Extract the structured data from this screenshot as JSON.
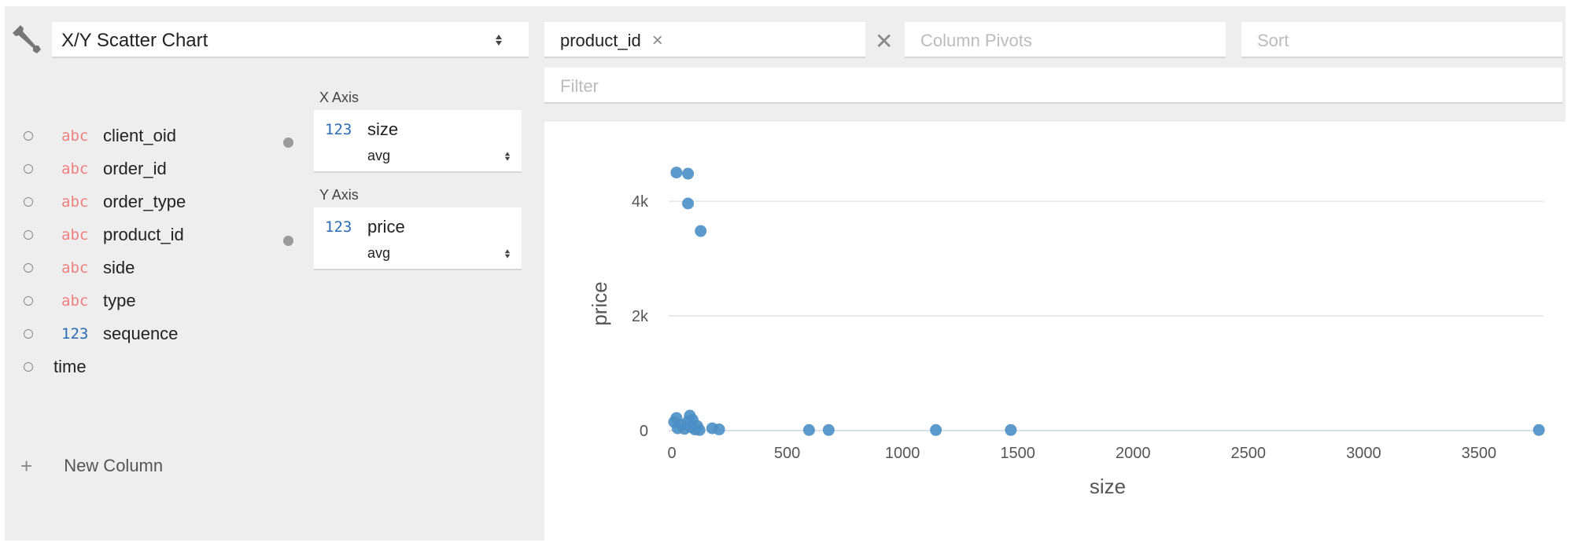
{
  "toolbar": {
    "chart_type": "X/Y Scatter Chart",
    "wrench_icon": "wrench-icon"
  },
  "columns": [
    {
      "type": "abc",
      "name": "client_oid"
    },
    {
      "type": "abc",
      "name": "order_id"
    },
    {
      "type": "abc",
      "name": "order_type"
    },
    {
      "type": "abc",
      "name": "product_id"
    },
    {
      "type": "abc",
      "name": "side"
    },
    {
      "type": "abc",
      "name": "type"
    },
    {
      "type": "123",
      "name": "sequence"
    },
    {
      "type": "",
      "name": "time"
    }
  ],
  "x_axis": {
    "label": "X Axis",
    "type": "123",
    "field": "size",
    "agg": "avg"
  },
  "y_axis": {
    "label": "Y Axis",
    "type": "123",
    "field": "price",
    "agg": "avg"
  },
  "new_column": {
    "plus": "+",
    "label": "New Column"
  },
  "row_pivots": {
    "chip": "product_id",
    "remove": "×"
  },
  "swap": "✕",
  "column_pivots": {
    "placeholder": "Column Pivots"
  },
  "sort": {
    "placeholder": "Sort"
  },
  "filter": {
    "placeholder": "Filter"
  },
  "colors": {
    "point": "#4a8fc5",
    "grid": "#dde6ee",
    "abc": "#f08080",
    "num": "#2b6cb5"
  },
  "chart_data": {
    "type": "scatter",
    "xlabel": "size",
    "ylabel": "price",
    "xlim": [
      0,
      3780
    ],
    "ylim": [
      0,
      4700
    ],
    "x_ticks": [
      0,
      500,
      1000,
      1500,
      2000,
      2500,
      3000,
      3500
    ],
    "x_tick_labels": [
      "0",
      "500",
      "1000",
      "1500",
      "2000",
      "2500",
      "3000",
      "3500"
    ],
    "y_ticks": [
      0,
      2000,
      4000
    ],
    "y_tick_labels": [
      "0",
      "2k",
      "4k"
    ],
    "grid": "horizontal",
    "points": [
      {
        "x": 20,
        "y": 4500
      },
      {
        "x": 70,
        "y": 4480
      },
      {
        "x": 70,
        "y": 3960
      },
      {
        "x": 125,
        "y": 3480
      },
      {
        "x": 10,
        "y": 150
      },
      {
        "x": 20,
        "y": 220
      },
      {
        "x": 25,
        "y": 40
      },
      {
        "x": 40,
        "y": 100
      },
      {
        "x": 55,
        "y": 30
      },
      {
        "x": 70,
        "y": 160
      },
      {
        "x": 78,
        "y": 260
      },
      {
        "x": 82,
        "y": 60
      },
      {
        "x": 90,
        "y": 190
      },
      {
        "x": 100,
        "y": 20
      },
      {
        "x": 110,
        "y": 80
      },
      {
        "x": 120,
        "y": 10
      },
      {
        "x": 175,
        "y": 40
      },
      {
        "x": 205,
        "y": 20
      },
      {
        "x": 595,
        "y": 10
      },
      {
        "x": 680,
        "y": 10
      },
      {
        "x": 1145,
        "y": 10
      },
      {
        "x": 1470,
        "y": 10
      },
      {
        "x": 3760,
        "y": 10
      }
    ]
  }
}
